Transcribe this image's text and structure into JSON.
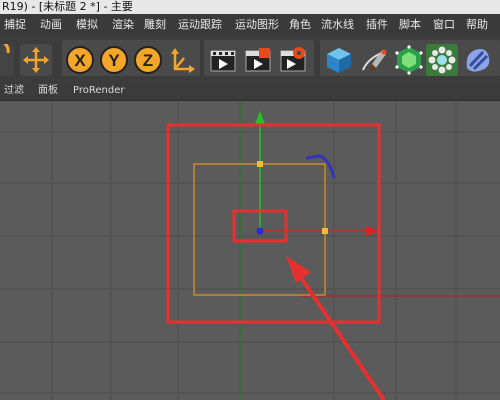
{
  "window": {
    "title": "R19) - [未标题 2 *] - 主要"
  },
  "menu": {
    "items": [
      "捕捉",
      "动画",
      "模拟",
      "渲染",
      "雕刻",
      "运动跟踪",
      "运动图形",
      "角色",
      "流水线",
      "插件",
      "脚本",
      "窗口",
      "帮助"
    ]
  },
  "toolbar": {
    "axis_x": "X",
    "axis_y": "Y",
    "axis_z": "Z",
    "icons": [
      "rotate-icon",
      "move-icon",
      "x-axis-lock",
      "y-axis-lock",
      "z-axis-lock",
      "coordinate-system-icon",
      "render-view-icon",
      "render-picture-viewer-icon",
      "render-settings-icon",
      "cube-icon",
      "pen-spline-icon",
      "subdivision-icon",
      "cloner-icon",
      "deformer-icon"
    ]
  },
  "viewport_menu": {
    "items": [
      "过滤",
      "面板",
      "ProRender"
    ]
  },
  "colors": {
    "accent_orange": "#f4a62a",
    "y_axis_green": "#28c028",
    "x_axis_red": "#e02020",
    "selection_box": "#c88a2a",
    "highlight_red": "#e53030",
    "object_axis_blue": "#3030d0"
  }
}
